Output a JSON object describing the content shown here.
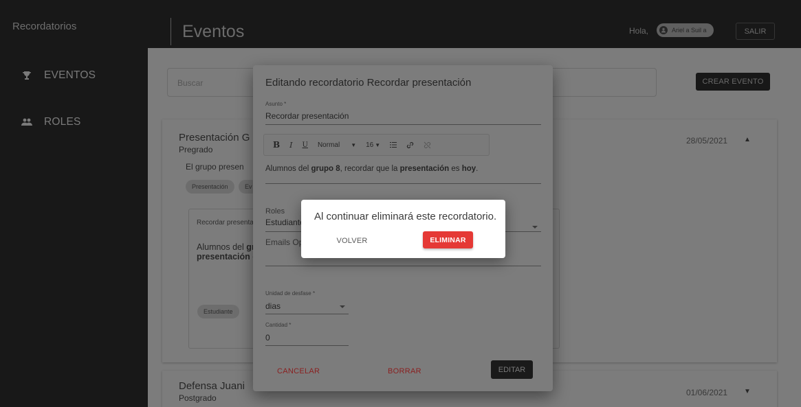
{
  "sidebar": {
    "brand": "Recordatorios",
    "items": [
      {
        "label": "EVENTOS",
        "icon": "trophy-icon"
      },
      {
        "label": "ROLES",
        "icon": "people-icon"
      }
    ]
  },
  "topbar": {
    "title": "Eventos",
    "greeting": "Hola,",
    "user_name": "Ariel a Suil a",
    "logout_label": "SALIR"
  },
  "search": {
    "placeholder": "Buscar"
  },
  "create_event_label": "CREAR EVENTO",
  "events": [
    {
      "title": "Presentación G",
      "subtitle": "Pregrado",
      "description": "El grupo presen",
      "date": "28/05/2021",
      "chips": [
        "Presentación",
        "Ev"
      ],
      "reminder": {
        "title": "Recordar presenta",
        "body_line1_normal": "Alumnos del ",
        "body_line1_bold": "gru",
        "body_line2_bold": "presentación",
        "body_line2_normal": " e",
        "chip": "Estudiante"
      }
    },
    {
      "title": "Defensa Juani",
      "subtitle": "Postgrado",
      "date": "01/06/2021"
    }
  ],
  "edit_dialog": {
    "title": "Editando recordatorio Recordar presentación",
    "subject_label": "Asunto *",
    "subject_value": "Recordar presentación",
    "toolbar": {
      "bold": "B",
      "italic": "I",
      "underline": "U",
      "style": "Normal",
      "size": "16"
    },
    "body": {
      "p1": "Alumnos del ",
      "b1": "grupo 8",
      "p2": ", recordar que la ",
      "b2": "presentación",
      "p3": " es ",
      "b3": "hoy",
      "p4": "."
    },
    "roles_label": "Roles",
    "roles_value": "Estudiante",
    "emails_label": "Emails Op",
    "unit_label": "Unidad de desfase *",
    "unit_value": "dias",
    "amount_label": "Cantidad *",
    "amount_value": "0",
    "cancel_label": "CANCELAR",
    "delete_label": "BORRAR",
    "edit_label": "EDITAR"
  },
  "confirm": {
    "message": "Al continuar eliminará este recordatorio.",
    "back_label": "VOLVER",
    "delete_label": "ELIMINAR"
  },
  "colors": {
    "danger": "#e53935",
    "dark": "#181818",
    "overlay_gray": "#7c7c7c"
  }
}
